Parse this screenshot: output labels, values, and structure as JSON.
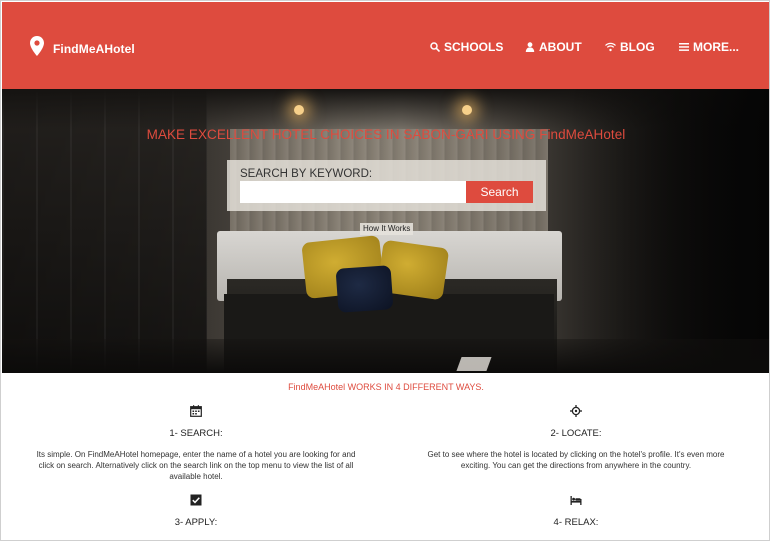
{
  "brand": {
    "name": "FindMeAHotel",
    "icon": "map-pin-icon"
  },
  "nav": {
    "items": [
      {
        "label": "SCHOOLS",
        "icon": "search-icon"
      },
      {
        "label": "ABOUT",
        "icon": "person-icon"
      },
      {
        "label": "BLOG",
        "icon": "wifi-icon"
      },
      {
        "label": "MORE...",
        "icon": "list-icon"
      }
    ]
  },
  "hero": {
    "title": "MAKE EXCELLENT HOTEL CHOICES IN SABON-GARI USING FindMeAHotel",
    "search_label": "SEARCH BY KEYWORD:",
    "search_value": "",
    "search_button": "Search",
    "how_it_works": "How It Works"
  },
  "ways": {
    "title": "FindMeAHotel WORKS IN 4 DIFFERENT WAYS.",
    "items": [
      {
        "icon": "calendar-icon",
        "title": "1- SEARCH:",
        "desc": "Its simple. On FindMeAHotel homepage, enter the name of a hotel you are looking for and click on search. Alternatively click on the search link on the top menu to view the list of all available hotel."
      },
      {
        "icon": "crosshair-icon",
        "title": "2- LOCATE:",
        "desc": "Get to see where the hotel is located by clicking on the hotel's profile. It's even more exciting. You can get the directions from anywhere in the country."
      },
      {
        "icon": "checkbox-icon",
        "title": "3- APPLY:",
        "desc": ""
      },
      {
        "icon": "bed-icon",
        "title": "4- RELAX:",
        "desc": ""
      }
    ]
  },
  "colors": {
    "accent": "#de4b3e",
    "text": "#222222"
  }
}
